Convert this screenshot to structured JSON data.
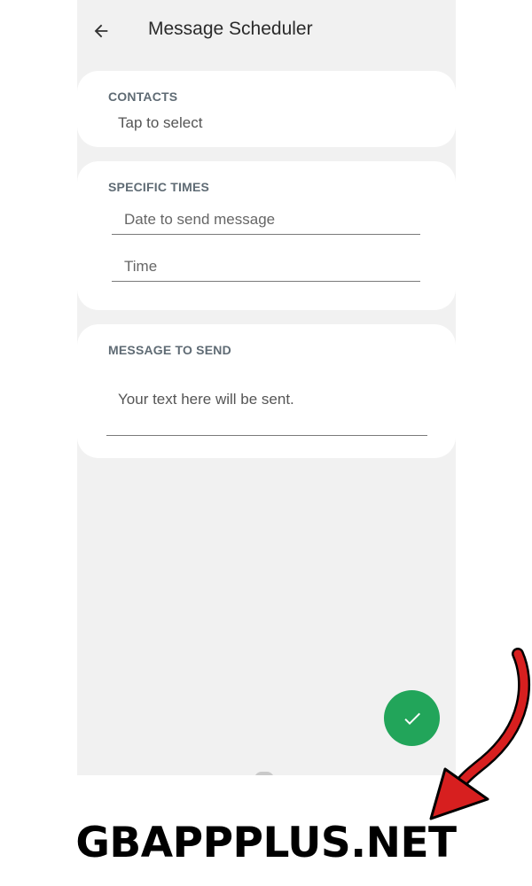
{
  "app": {
    "title": "Message Scheduler",
    "back_icon": "arrow-left-icon"
  },
  "contacts": {
    "header": "CONTACTS",
    "value": "Tap to select"
  },
  "specific_times": {
    "header": "SPECIFIC TIMES",
    "date_placeholder": "Date to send message",
    "time_placeholder": "Time"
  },
  "message": {
    "header": "MESSAGE TO SEND",
    "placeholder": "Your text here will be sent."
  },
  "fab": {
    "icon": "check-icon",
    "color": "#22a55a"
  },
  "watermark": {
    "text": "GBAPPPLUS.NET",
    "arrow_color": "#d71f1f"
  }
}
